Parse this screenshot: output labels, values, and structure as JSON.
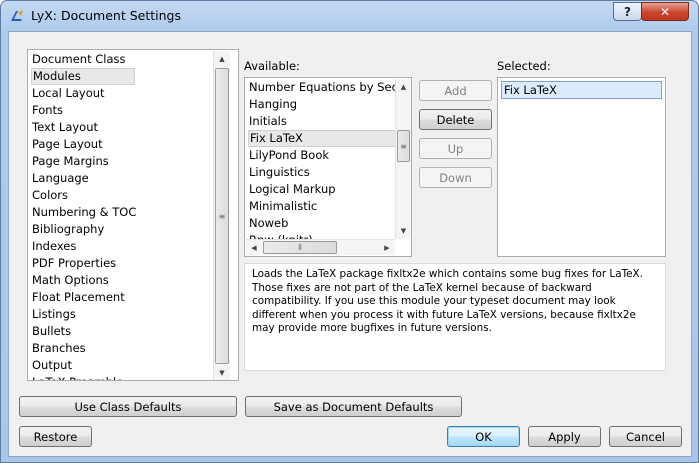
{
  "window": {
    "title": "LyX: Document Settings",
    "help_label": "?",
    "close_label": "✕"
  },
  "sidebar": {
    "items": [
      "Document Class",
      "Modules",
      "Local Layout",
      "Fonts",
      "Text Layout",
      "Page Layout",
      "Page Margins",
      "Language",
      "Colors",
      "Numbering & TOC",
      "Bibliography",
      "Indexes",
      "PDF Properties",
      "Math Options",
      "Float Placement",
      "Listings",
      "Bullets",
      "Branches",
      "Output",
      "LaTeX Preamble"
    ],
    "selected": "Modules"
  },
  "modules": {
    "available_label": "Available:",
    "selected_label": "Selected:",
    "available": [
      "Number Equations by Section",
      "Hanging",
      "Initials",
      "Fix LaTeX",
      "LilyPond Book",
      "Linguistics",
      "Logical Markup",
      "Minimalistic",
      "Noweb",
      "Rnw (knitr)"
    ],
    "available_highlighted": "Fix LaTeX",
    "selected": [
      "Fix LaTeX"
    ],
    "buttons": {
      "add": "Add",
      "delete": "Delete",
      "up": "Up",
      "down": "Down"
    },
    "description": "Loads the LaTeX package fixltx2e which contains some bug fixes for LaTeX. Those fixes are not part of the LaTeX kernel because of backward compatibility. If you use this module your typeset document may look different when you process it with future LaTeX versions, because fixltx2e may provide more bugfixes in future versions."
  },
  "footer": {
    "use_class_defaults": "Use Class Defaults",
    "save_as_defaults": "Save as Document Defaults",
    "restore": "Restore",
    "ok": "OK",
    "apply": "Apply",
    "cancel": "Cancel"
  },
  "colors": {
    "title_gradient_top": "#c3d9f2",
    "close_button": "#c9462c",
    "selection_highlight": "#ddecfc",
    "dialog_background": "#f0f0f0"
  },
  "icons": {
    "app": "lyx-app-icon",
    "scroll_up": "scroll-up-arrow-icon",
    "scroll_down": "scroll-down-arrow-icon",
    "scroll_left": "scroll-left-arrow-icon",
    "scroll_right": "scroll-right-arrow-icon"
  }
}
